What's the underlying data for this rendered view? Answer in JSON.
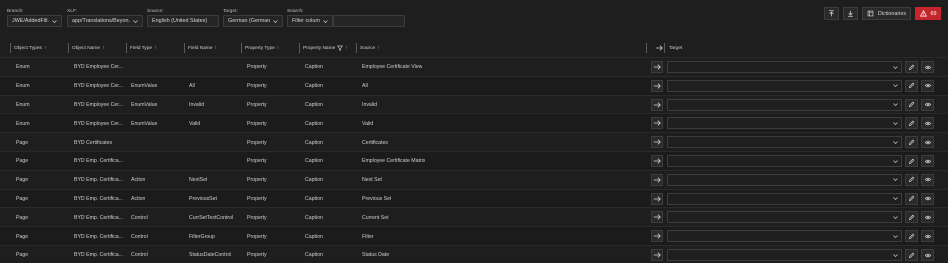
{
  "filters": {
    "branch": {
      "label": "Branch:",
      "value": "JWE/AddedFilt..."
    },
    "xlf": {
      "label": "XLF:",
      "value": "app/Translations/Beyon..."
    },
    "source": {
      "label": "Source:",
      "value": "English (United States)"
    },
    "target": {
      "label": "Target:",
      "value": "German (Germany)"
    },
    "search": {
      "label": "Search:",
      "column_value": "Filter column",
      "query_value": ""
    }
  },
  "toolbar": {
    "dictionaries_label": "Dictionaries",
    "error_count": "69"
  },
  "columns": {
    "object_types": "Object Types",
    "object_name": "Object Name",
    "field_type": "Field Type",
    "field_name": "Field Name",
    "property_type": "Property Type",
    "property_name": "Property Name",
    "source": "Source",
    "target": "Target"
  },
  "rows": [
    {
      "object_type": "Enum",
      "object_name": "BYD Employee Cer...",
      "field_type": "",
      "field_name": "",
      "property_type": "Property",
      "property_name": "Caption",
      "source": "Employee Certificate View"
    },
    {
      "object_type": "Enum",
      "object_name": "BYD Employee Cer...",
      "field_type": "EnumValue",
      "field_name": "All",
      "property_type": "Property",
      "property_name": "Caption",
      "source": "All"
    },
    {
      "object_type": "Enum",
      "object_name": "BYD Employee Cer...",
      "field_type": "EnumValue",
      "field_name": "Invalid",
      "property_type": "Property",
      "property_name": "Caption",
      "source": "Invalid"
    },
    {
      "object_type": "Enum",
      "object_name": "BYD Employee Cer...",
      "field_type": "EnumValue",
      "field_name": "Valid",
      "property_type": "Property",
      "property_name": "Caption",
      "source": "Valid"
    },
    {
      "object_type": "Page",
      "object_name": "BYD Certificates",
      "field_type": "",
      "field_name": "",
      "property_type": "Property",
      "property_name": "Caption",
      "source": "Certificates"
    },
    {
      "object_type": "Page",
      "object_name": "BYD Emp. Certifica...",
      "field_type": "",
      "field_name": "",
      "property_type": "Property",
      "property_name": "Caption",
      "source": "Employee Certificate Matrix"
    },
    {
      "object_type": "Page",
      "object_name": "BYD Emp. Certifica...",
      "field_type": "Action",
      "field_name": "NextSet",
      "property_type": "Property",
      "property_name": "Caption",
      "source": "Next Set"
    },
    {
      "object_type": "Page",
      "object_name": "BYD Emp. Certifica...",
      "field_type": "Action",
      "field_name": "PreviousSet",
      "property_type": "Property",
      "property_name": "Caption",
      "source": "Previous Set"
    },
    {
      "object_type": "Page",
      "object_name": "BYD Emp. Certifica...",
      "field_type": "Control",
      "field_name": "CurrSetTextControl",
      "property_type": "Property",
      "property_name": "Caption",
      "source": "Current Set"
    },
    {
      "object_type": "Page",
      "object_name": "BYD Emp. Certifica...",
      "field_type": "Control",
      "field_name": "FilterGroup",
      "property_type": "Property",
      "property_name": "Caption",
      "source": "Filter"
    },
    {
      "object_type": "Page",
      "object_name": "BYD Emp. Certifica...",
      "field_type": "Control",
      "field_name": "StatusDateControl",
      "property_type": "Property",
      "property_name": "Caption",
      "source": "Status Date"
    }
  ],
  "colors": {
    "background": "#1e1e1e",
    "error_badge": "#c5262c",
    "border": "#3c3c3c"
  }
}
